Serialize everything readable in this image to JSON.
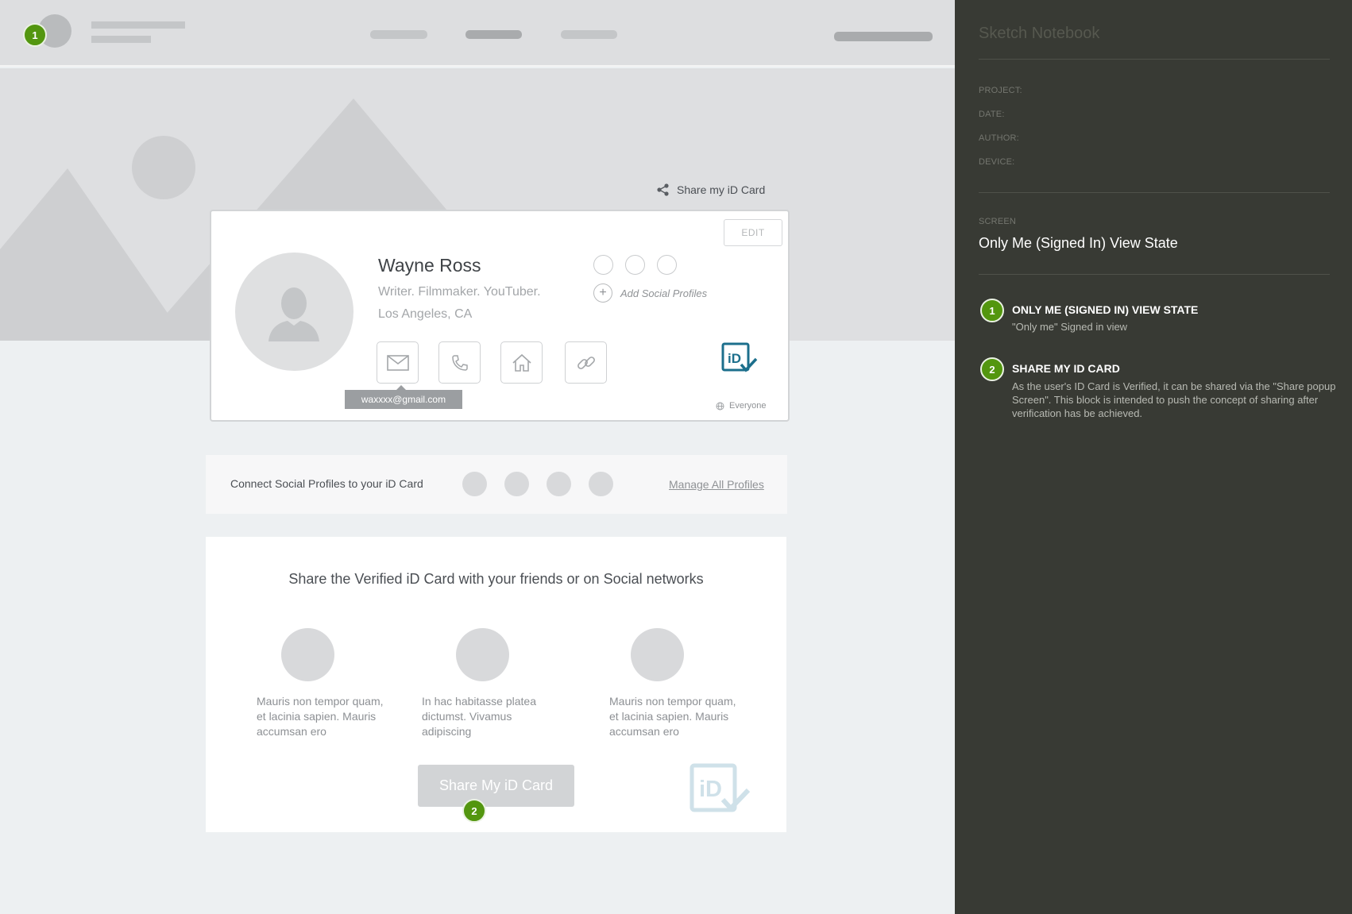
{
  "share_link": {
    "label": "Share my iD Card"
  },
  "profile": {
    "name": "Wayne Ross",
    "tagline": "Writer. Filmmaker. YouTuber.",
    "location": "Los Angeles, CA",
    "edit_label": "EDIT",
    "add_social_label": "Add Social Profiles",
    "email_tooltip": "waxxxx@gmail.com",
    "visibility_label": "Everyone"
  },
  "connect": {
    "label": "Connect Social Profiles to your iD Card",
    "manage_label": "Manage All Profiles"
  },
  "share_section": {
    "heading": "Share the Verified iD Card with your friends or on Social networks",
    "features": [
      {
        "text": "Mauris non tempor quam, et lacinia sapien. Mauris accumsan ero"
      },
      {
        "text": "In hac habitasse platea dictumst. Vivamus adipiscing"
      },
      {
        "text": "Mauris non tempor quam, et lacinia sapien. Mauris accumsan ero"
      }
    ],
    "button_label": "Share My iD Card"
  },
  "badges": {
    "one": "1",
    "two": "2"
  },
  "sidebar": {
    "title": "Sketch Notebook",
    "fields": {
      "project": "PROJECT:",
      "date": "DATE:",
      "author": "AUTHOR:",
      "device": "DEVICE:"
    },
    "screen_label": "SCREEN",
    "screen_name": "Only Me (Signed In) View State",
    "notes": [
      {
        "number": "1",
        "title": "ONLY ME (SIGNED IN) VIEW STATE",
        "body": "\"Only me\" Signed in view"
      },
      {
        "number": "2",
        "title": "SHARE MY ID CARD",
        "body": "As the user's ID Card is Verified, it can be shared via the \"Share popup Screen\". This block is intended to push the concept of sharing after verification has be achieved."
      }
    ]
  },
  "colors": {
    "badge": "#53960f",
    "sidebar_bg": "#383a34",
    "brand_teal": "#1c6f8c"
  }
}
